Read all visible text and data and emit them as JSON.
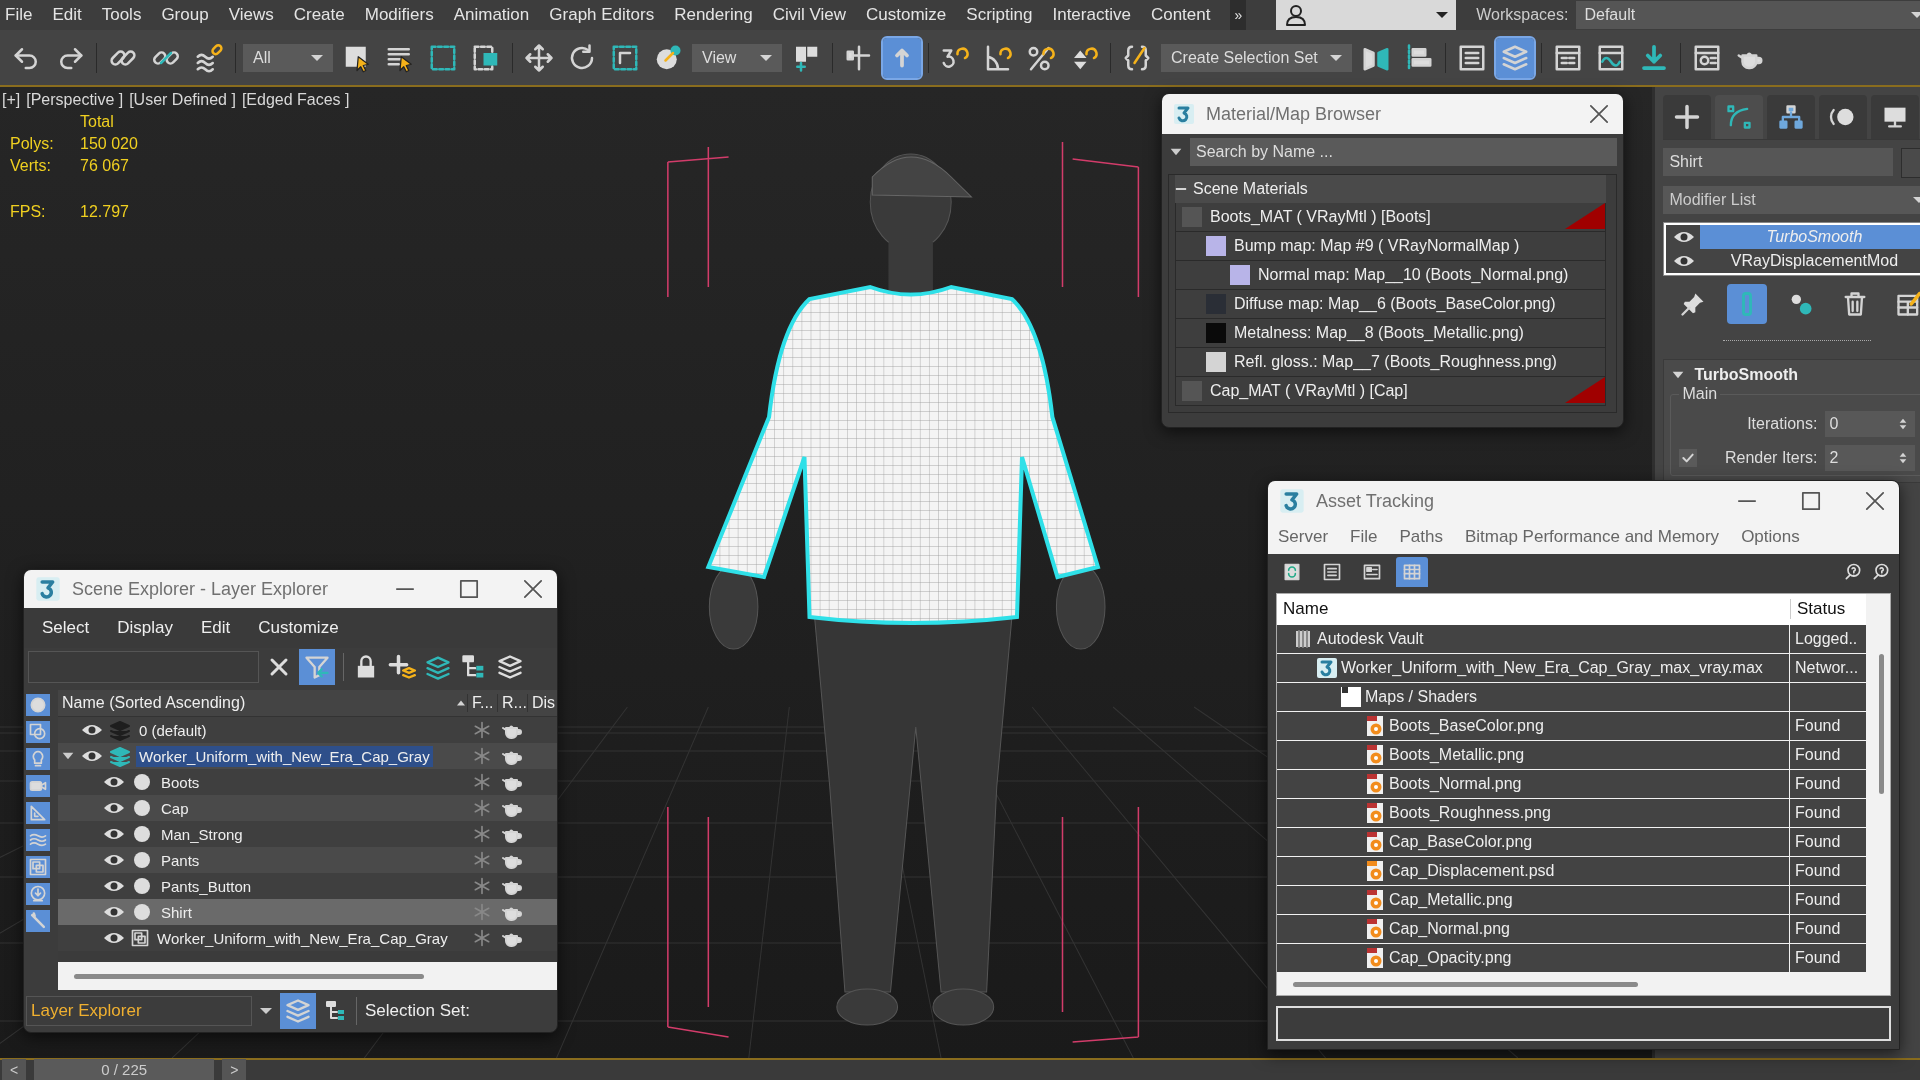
{
  "menu_bar": {
    "items": [
      "File",
      "Edit",
      "Tools",
      "Group",
      "Views",
      "Create",
      "Modifiers",
      "Animation",
      "Graph Editors",
      "Rendering",
      "Civil View",
      "Customize",
      "Scripting",
      "Interactive",
      "Content"
    ],
    "overflow": "»",
    "workspaces_label": "Workspaces:",
    "workspace": "Default"
  },
  "toolbar": {
    "groups": [
      [
        {
          "kind": "undo",
          "selected": false
        },
        {
          "kind": "redo",
          "selected": false
        }
      ],
      [
        {
          "kind": "link",
          "selected": false
        },
        {
          "kind": "unlink",
          "selected": false
        },
        {
          "kind": "bind",
          "selected": false
        }
      ],
      [
        {
          "kind": "dropdown",
          "value": "All"
        },
        {
          "kind": "select",
          "selected": false
        },
        {
          "kind": "select-list",
          "selected": false
        },
        {
          "kind": "region",
          "selected": false
        },
        {
          "kind": "crossing",
          "selected": false
        }
      ],
      [
        {
          "kind": "move",
          "selected": false
        },
        {
          "kind": "rotate",
          "selected": false
        },
        {
          "kind": "scale",
          "selected": false
        },
        {
          "kind": "place",
          "selected": false
        },
        {
          "kind": "dropdown",
          "value": "View"
        },
        {
          "kind": "pivot",
          "selected": false
        }
      ],
      [
        {
          "kind": "manipulate",
          "selected": false
        },
        {
          "kind": "shortcut",
          "selected": true
        }
      ],
      [
        {
          "kind": "snap",
          "selected": false
        },
        {
          "kind": "angle-snap",
          "selected": false
        },
        {
          "kind": "percent-snap",
          "selected": false
        },
        {
          "kind": "spinner-snap",
          "selected": false
        }
      ],
      [
        {
          "kind": "named-sets",
          "selected": false
        },
        {
          "kind": "dropdown",
          "value": "Create Selection Set"
        },
        {
          "kind": "mirror",
          "selected": false
        },
        {
          "kind": "align",
          "selected": false
        }
      ],
      [
        {
          "kind": "list",
          "selected": false
        },
        {
          "kind": "layers",
          "selected": true
        }
      ],
      [
        {
          "kind": "ribbon",
          "selected": false
        },
        {
          "kind": "curve",
          "selected": false
        },
        {
          "kind": "schematic",
          "selected": false
        }
      ],
      [
        {
          "kind": "material",
          "selected": false
        },
        {
          "kind": "teapot",
          "selected": false
        }
      ]
    ]
  },
  "viewport": {
    "labels": [
      "[+]",
      "[Perspective ]",
      "[User Defined ]",
      "[Edged Faces ]"
    ],
    "stats_header": "Total",
    "stats": [
      {
        "label": "Polys:",
        "value": "150 020"
      },
      {
        "label": "Verts:",
        "value": "76 067"
      }
    ],
    "fps": {
      "label": "FPS:",
      "value": "12.797"
    }
  },
  "material_browser": {
    "title": "Material/Map Browser",
    "search_placeholder": "Search by Name ...",
    "section": {
      "title": "Scene Materials",
      "expanded": true,
      "items": [
        {
          "name": "Boots_MAT  ( VRayMtl )  [Boots]",
          "kind": "material",
          "children": [
            {
              "name": "Bump map: Map #9  ( VRayNormalMap )",
              "kind": "normal",
              "children": [
                {
                  "name": "Normal map: Map__10 (Boots_Normal.png)",
                  "kind": "normal"
                }
              ]
            },
            {
              "name": "Diffuse map: Map__6 (Boots_BaseColor.png)",
              "kind": "diffuse"
            },
            {
              "name": "Metalness: Map__8 (Boots_Metallic.png)",
              "kind": "metal"
            },
            {
              "name": "Refl. gloss.: Map__7 (Boots_Roughness.png)",
              "kind": "gloss"
            }
          ]
        },
        {
          "name": "Cap_MAT  ( VRayMtl )  [Cap]",
          "kind": "material"
        }
      ]
    }
  },
  "command_panel": {
    "tabs": [
      {
        "kind": "create",
        "selected": false
      },
      {
        "kind": "modify",
        "selected": true
      },
      {
        "kind": "hierarchy",
        "selected": false
      },
      {
        "kind": "motion",
        "selected": false
      },
      {
        "kind": "display",
        "selected": false
      }
    ],
    "object_name": "Shirt",
    "modifier_list": "Modifier List",
    "stack": [
      {
        "name": "TurboSmooth",
        "selected": true,
        "visible": true
      },
      {
        "name": "VRayDisplacementMod",
        "selected": false,
        "visible": true
      }
    ],
    "stack_tools": [
      {
        "kind": "pin",
        "selected": false
      },
      {
        "kind": "end-result",
        "selected": true
      },
      {
        "kind": "unique",
        "selected": false
      },
      {
        "kind": "remove",
        "selected": false
      },
      {
        "kind": "configure",
        "selected": false
      }
    ],
    "rollout": {
      "title": "TurboSmooth",
      "expanded": true,
      "group": "Main",
      "iterations_label": "Iterations:",
      "iterations": "0",
      "render_iters_label": "Render Iters:",
      "render_iters": "2",
      "render_iters_checked": true
    }
  },
  "scene_explorer": {
    "title": "Scene Explorer - Layer Explorer",
    "menu": [
      "Select",
      "Display",
      "Edit",
      "Customize"
    ],
    "filter_active": true,
    "side_filters": [
      {
        "kind": "geometry",
        "selected": true
      },
      {
        "kind": "shapes",
        "selected": true
      },
      {
        "kind": "lights",
        "selected": true
      },
      {
        "kind": "cameras",
        "selected": true
      },
      {
        "kind": "helpers",
        "selected": true
      },
      {
        "kind": "spacewarps",
        "selected": true
      },
      {
        "kind": "groups",
        "selected": true
      },
      {
        "kind": "xrefs",
        "selected": true
      },
      {
        "kind": "bones",
        "selected": true
      }
    ],
    "columns": [
      "Name (Sorted Ascending)",
      "F...",
      "R...",
      "Dis"
    ],
    "tree": [
      {
        "name": "0 (default)",
        "kind": "layer",
        "current": false,
        "visible": true,
        "selected": false
      },
      {
        "name": "Worker_Uniform_with_New_Era_Cap_Gray",
        "kind": "layer",
        "current": true,
        "visible": true,
        "selected": true,
        "expanded": true,
        "children": [
          {
            "name": "Boots",
            "kind": "object",
            "visible": true,
            "selected": false
          },
          {
            "name": "Cap",
            "kind": "object",
            "visible": true,
            "selected": false
          },
          {
            "name": "Man_Strong",
            "kind": "object",
            "visible": true,
            "selected": false
          },
          {
            "name": "Pants",
            "kind": "object",
            "visible": true,
            "selected": false
          },
          {
            "name": "Pants_Button",
            "kind": "object",
            "visible": true,
            "selected": false
          },
          {
            "name": "Shirt",
            "kind": "object",
            "visible": true,
            "selected": true
          },
          {
            "name": "Worker_Uniform_with_New_Era_Cap_Gray",
            "kind": "container",
            "visible": true,
            "selected": false
          }
        ]
      }
    ],
    "explorer_mode": "Layer Explorer",
    "selection_set_label": "Selection Set:"
  },
  "asset_tracking": {
    "title": "Asset Tracking",
    "menu": [
      "Server",
      "File",
      "Paths",
      "Bitmap Performance and Memory",
      "Options"
    ],
    "view_modes": [
      {
        "kind": "refresh",
        "selected": false
      },
      {
        "kind": "list",
        "selected": false
      },
      {
        "kind": "thumbs",
        "selected": false
      },
      {
        "kind": "table",
        "selected": true
      }
    ],
    "columns": [
      "Name",
      "Status"
    ],
    "rows": [
      {
        "name": "Autodesk Vault",
        "status": "Logged..",
        "kind": "vault",
        "children": [
          {
            "name": "Worker_Uniform_with_New_Era_Cap_Gray_max_vray.max",
            "status": "Networ...",
            "kind": "max",
            "children": [
              {
                "name": "Maps / Shaders",
                "kind": "folder",
                "children": [
                  {
                    "name": "Boots_BaseColor.png",
                    "status": "Found",
                    "kind": "image"
                  },
                  {
                    "name": "Boots_Metallic.png",
                    "status": "Found",
                    "kind": "image"
                  },
                  {
                    "name": "Boots_Normal.png",
                    "status": "Found",
                    "kind": "image"
                  },
                  {
                    "name": "Boots_Roughness.png",
                    "status": "Found",
                    "kind": "image"
                  },
                  {
                    "name": "Cap_BaseColor.png",
                    "status": "Found",
                    "kind": "image"
                  },
                  {
                    "name": "Cap_Displacement.psd",
                    "status": "Found",
                    "kind": "psd"
                  },
                  {
                    "name": "Cap_Metallic.png",
                    "status": "Found",
                    "kind": "image"
                  },
                  {
                    "name": "Cap_Normal.png",
                    "status": "Found",
                    "kind": "image"
                  },
                  {
                    "name": "Cap_Opacity.png",
                    "status": "Found",
                    "kind": "image"
                  }
                ]
              }
            ]
          }
        ]
      }
    ]
  },
  "timeline": {
    "prev": "<",
    "position": "0 / 225",
    "next": ">"
  }
}
